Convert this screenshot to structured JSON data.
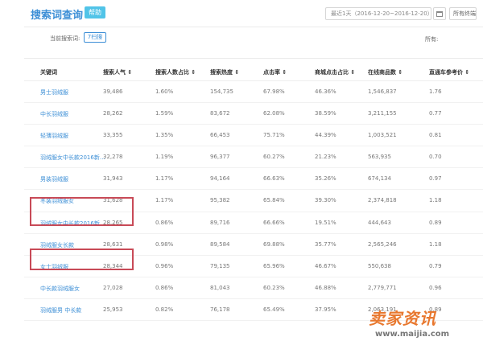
{
  "header": {
    "title": "搜索词查询",
    "badge": "帮助"
  },
  "toolbar": {
    "date_range": "最近1天（2016-12-20~2016-12-20）",
    "period_select": "所有终端"
  },
  "filter": {
    "label": "当前搜索词:",
    "chip": "7扫搜"
  },
  "right_filter_label": "所有:",
  "table": {
    "headers": [
      "关键词",
      "搜索人气 ⇕",
      "搜索人数占比 ⇕",
      "搜索热度 ⇕",
      "点击率 ⇕",
      "商城点击占比 ⇕",
      "在线商品数 ⇕",
      "直通车参考价 ⇕"
    ],
    "rows": [
      [
        "男士羽绒服",
        "39,486",
        "1.60%",
        "154,735",
        "67.98%",
        "46.36%",
        "1,546,837",
        "1.76"
      ],
      [
        "中长羽绒服",
        "28,262",
        "1.59%",
        "83,672",
        "62.08%",
        "38.59%",
        "3,211,155",
        "0.77"
      ],
      [
        "轻薄羽绒服",
        "33,355",
        "1.35%",
        "66,453",
        "75.71%",
        "44.39%",
        "1,003,521",
        "0.81"
      ],
      [
        "羽绒服女中长款2016新…",
        "32,278",
        "1.19%",
        "96,377",
        "60.27%",
        "21.23%",
        "563,935",
        "0.70"
      ],
      [
        "男装羽绒服",
        "31,943",
        "1.17%",
        "94,164",
        "66.63%",
        "35.26%",
        "674,134",
        "0.97"
      ],
      [
        "冬装羽绒服女",
        "31,628",
        "1.17%",
        "95,382",
        "65.84%",
        "39.30%",
        "2,374,818",
        "1.18"
      ],
      [
        "羽绒服女中长款2016新…",
        "28,265",
        "0.86%",
        "89,716",
        "66.66%",
        "19.51%",
        "444,643",
        "0.89"
      ],
      [
        "羽绒服女长款",
        "28,631",
        "0.98%",
        "89,584",
        "69.88%",
        "35.77%",
        "2,565,246",
        "1.18"
      ],
      [
        "女士羽绒服",
        "28,344",
        "0.96%",
        "79,135",
        "65.96%",
        "46.67%",
        "550,638",
        "0.79"
      ],
      [
        "中长款羽绒服女",
        "27,028",
        "0.86%",
        "81,043",
        "60.23%",
        "46.88%",
        "2,779,771",
        "0.96"
      ],
      [
        "羽绒服男 中长款",
        "25,953",
        "0.82%",
        "76,178",
        "65.49%",
        "37.95%",
        "2,063,191",
        "0.89"
      ]
    ]
  },
  "watermark": {
    "brand": "卖家资讯",
    "url": "www.maijia.com"
  },
  "colors": {
    "accent": "#3d8fd6",
    "badge": "#51c4e8",
    "highlight": "#c84a57"
  }
}
